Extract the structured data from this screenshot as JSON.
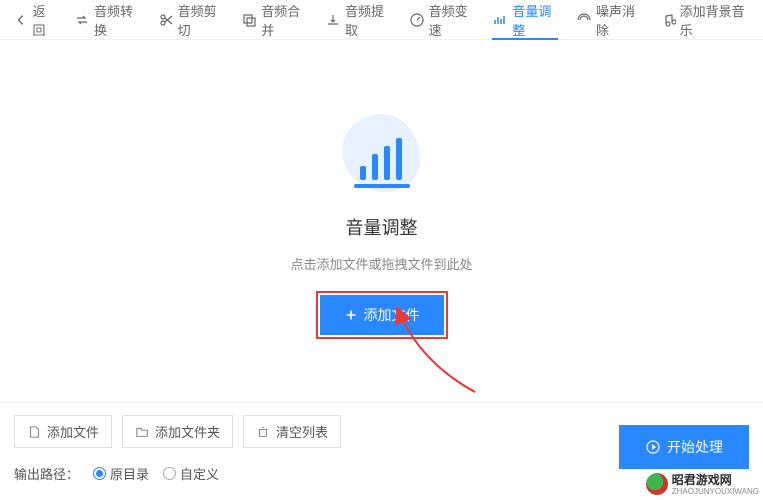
{
  "topbar": {
    "back": "返回",
    "items": [
      {
        "label": "音频转换"
      },
      {
        "label": "音频剪切"
      },
      {
        "label": "音频合并"
      },
      {
        "label": "音频提取"
      },
      {
        "label": "音频变速"
      },
      {
        "label": "音量调整",
        "active": true
      },
      {
        "label": "噪声消除"
      },
      {
        "label": "添加背景音乐"
      }
    ]
  },
  "main": {
    "title": "音量调整",
    "subtitle": "点击添加文件或拖拽文件到此处",
    "add_label": "添加文件"
  },
  "bottom": {
    "add_file": "添加文件",
    "add_folder": "添加文件夹",
    "clear_list": "清空列表",
    "start": "开始处理",
    "out_label": "输出路径：",
    "radio_source": "原目录",
    "radio_custom": "自定义"
  },
  "watermark": {
    "title": "昭君游戏网",
    "sub": "ZHAOJUNYOUXIWANG"
  }
}
